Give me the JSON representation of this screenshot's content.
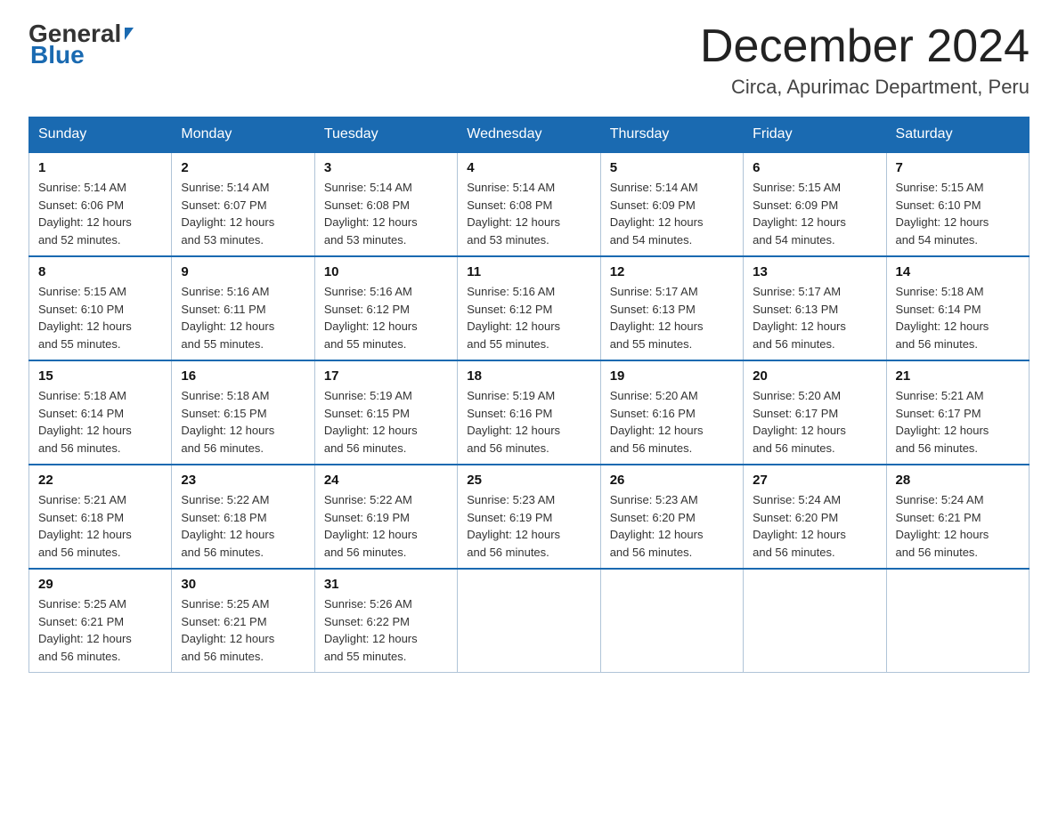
{
  "header": {
    "logo_general": "General",
    "logo_blue": "Blue",
    "month_title": "December 2024",
    "location": "Circa, Apurimac Department, Peru"
  },
  "days_of_week": [
    "Sunday",
    "Monday",
    "Tuesday",
    "Wednesday",
    "Thursday",
    "Friday",
    "Saturday"
  ],
  "weeks": [
    [
      {
        "day": "1",
        "sunrise": "5:14 AM",
        "sunset": "6:06 PM",
        "daylight": "12 hours and 52 minutes."
      },
      {
        "day": "2",
        "sunrise": "5:14 AM",
        "sunset": "6:07 PM",
        "daylight": "12 hours and 53 minutes."
      },
      {
        "day": "3",
        "sunrise": "5:14 AM",
        "sunset": "6:08 PM",
        "daylight": "12 hours and 53 minutes."
      },
      {
        "day": "4",
        "sunrise": "5:14 AM",
        "sunset": "6:08 PM",
        "daylight": "12 hours and 53 minutes."
      },
      {
        "day": "5",
        "sunrise": "5:14 AM",
        "sunset": "6:09 PM",
        "daylight": "12 hours and 54 minutes."
      },
      {
        "day": "6",
        "sunrise": "5:15 AM",
        "sunset": "6:09 PM",
        "daylight": "12 hours and 54 minutes."
      },
      {
        "day": "7",
        "sunrise": "5:15 AM",
        "sunset": "6:10 PM",
        "daylight": "12 hours and 54 minutes."
      }
    ],
    [
      {
        "day": "8",
        "sunrise": "5:15 AM",
        "sunset": "6:10 PM",
        "daylight": "12 hours and 55 minutes."
      },
      {
        "day": "9",
        "sunrise": "5:16 AM",
        "sunset": "6:11 PM",
        "daylight": "12 hours and 55 minutes."
      },
      {
        "day": "10",
        "sunrise": "5:16 AM",
        "sunset": "6:12 PM",
        "daylight": "12 hours and 55 minutes."
      },
      {
        "day": "11",
        "sunrise": "5:16 AM",
        "sunset": "6:12 PM",
        "daylight": "12 hours and 55 minutes."
      },
      {
        "day": "12",
        "sunrise": "5:17 AM",
        "sunset": "6:13 PM",
        "daylight": "12 hours and 55 minutes."
      },
      {
        "day": "13",
        "sunrise": "5:17 AM",
        "sunset": "6:13 PM",
        "daylight": "12 hours and 56 minutes."
      },
      {
        "day": "14",
        "sunrise": "5:18 AM",
        "sunset": "6:14 PM",
        "daylight": "12 hours and 56 minutes."
      }
    ],
    [
      {
        "day": "15",
        "sunrise": "5:18 AM",
        "sunset": "6:14 PM",
        "daylight": "12 hours and 56 minutes."
      },
      {
        "day": "16",
        "sunrise": "5:18 AM",
        "sunset": "6:15 PM",
        "daylight": "12 hours and 56 minutes."
      },
      {
        "day": "17",
        "sunrise": "5:19 AM",
        "sunset": "6:15 PM",
        "daylight": "12 hours and 56 minutes."
      },
      {
        "day": "18",
        "sunrise": "5:19 AM",
        "sunset": "6:16 PM",
        "daylight": "12 hours and 56 minutes."
      },
      {
        "day": "19",
        "sunrise": "5:20 AM",
        "sunset": "6:16 PM",
        "daylight": "12 hours and 56 minutes."
      },
      {
        "day": "20",
        "sunrise": "5:20 AM",
        "sunset": "6:17 PM",
        "daylight": "12 hours and 56 minutes."
      },
      {
        "day": "21",
        "sunrise": "5:21 AM",
        "sunset": "6:17 PM",
        "daylight": "12 hours and 56 minutes."
      }
    ],
    [
      {
        "day": "22",
        "sunrise": "5:21 AM",
        "sunset": "6:18 PM",
        "daylight": "12 hours and 56 minutes."
      },
      {
        "day": "23",
        "sunrise": "5:22 AM",
        "sunset": "6:18 PM",
        "daylight": "12 hours and 56 minutes."
      },
      {
        "day": "24",
        "sunrise": "5:22 AM",
        "sunset": "6:19 PM",
        "daylight": "12 hours and 56 minutes."
      },
      {
        "day": "25",
        "sunrise": "5:23 AM",
        "sunset": "6:19 PM",
        "daylight": "12 hours and 56 minutes."
      },
      {
        "day": "26",
        "sunrise": "5:23 AM",
        "sunset": "6:20 PM",
        "daylight": "12 hours and 56 minutes."
      },
      {
        "day": "27",
        "sunrise": "5:24 AM",
        "sunset": "6:20 PM",
        "daylight": "12 hours and 56 minutes."
      },
      {
        "day": "28",
        "sunrise": "5:24 AM",
        "sunset": "6:21 PM",
        "daylight": "12 hours and 56 minutes."
      }
    ],
    [
      {
        "day": "29",
        "sunrise": "5:25 AM",
        "sunset": "6:21 PM",
        "daylight": "12 hours and 56 minutes."
      },
      {
        "day": "30",
        "sunrise": "5:25 AM",
        "sunset": "6:21 PM",
        "daylight": "12 hours and 56 minutes."
      },
      {
        "day": "31",
        "sunrise": "5:26 AM",
        "sunset": "6:22 PM",
        "daylight": "12 hours and 55 minutes."
      },
      null,
      null,
      null,
      null
    ]
  ],
  "labels": {
    "sunrise": "Sunrise:",
    "sunset": "Sunset:",
    "daylight": "Daylight:"
  }
}
